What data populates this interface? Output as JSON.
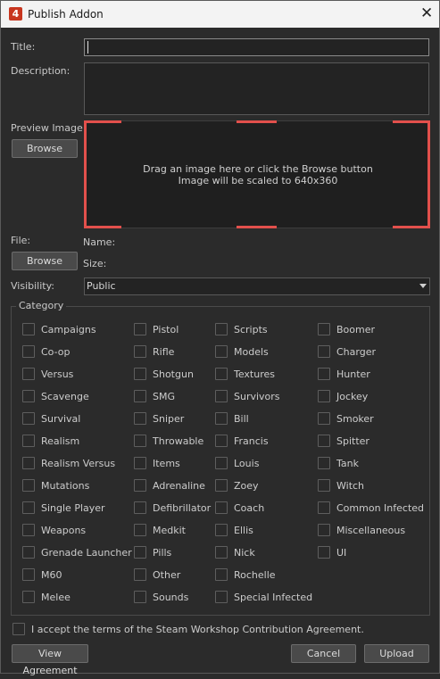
{
  "window": {
    "title": "Publish Addon",
    "app_icon_text": "4",
    "close_glyph": "✕"
  },
  "labels": {
    "title": "Title:",
    "description": "Description:",
    "preview_image": "Preview Image:",
    "file": "File:",
    "name": "Name:",
    "size": "Size:",
    "visibility": "Visibility:",
    "category": "Category"
  },
  "fields": {
    "title_value": "",
    "description_value": ""
  },
  "preview": {
    "browse": "Browse",
    "line1": "Drag an image here or click the Browse button",
    "line2": "Image will be scaled to 640x360"
  },
  "file": {
    "browse": "Browse"
  },
  "visibility": {
    "selected": "Public"
  },
  "categories": {
    "col1": [
      "Campaigns",
      "Co-op",
      "Versus",
      "Scavenge",
      "Survival",
      "Realism",
      "Realism Versus",
      "Mutations",
      "Single Player",
      "Weapons",
      "Grenade Launcher",
      "M60",
      "Melee"
    ],
    "col2": [
      "Pistol",
      "Rifle",
      "Shotgun",
      "SMG",
      "Sniper",
      "Throwable",
      "Items",
      "Adrenaline",
      "Defibrillator",
      "Medkit",
      "Pills",
      "Other",
      "Sounds"
    ],
    "col3": [
      "Scripts",
      "Models",
      "Textures",
      "Survivors",
      "Bill",
      "Francis",
      "Louis",
      "Zoey",
      "Coach",
      "Ellis",
      "Nick",
      "Rochelle",
      "Special Infected"
    ],
    "col4": [
      "Boomer",
      "Charger",
      "Hunter",
      "Jockey",
      "Smoker",
      "Spitter",
      "Tank",
      "Witch",
      "Common Infected",
      "Miscellaneous",
      "UI"
    ]
  },
  "agreement": {
    "text": "I accept the terms of the Steam Workshop Contribution Agreement.",
    "checked": false
  },
  "footer": {
    "view_agreement": "View Agreement",
    "cancel": "Cancel",
    "upload": "Upload"
  },
  "colors": {
    "background": "#2b2b2b",
    "preview_corner": "#e2504c",
    "titlebar": "#f3f3f3"
  }
}
